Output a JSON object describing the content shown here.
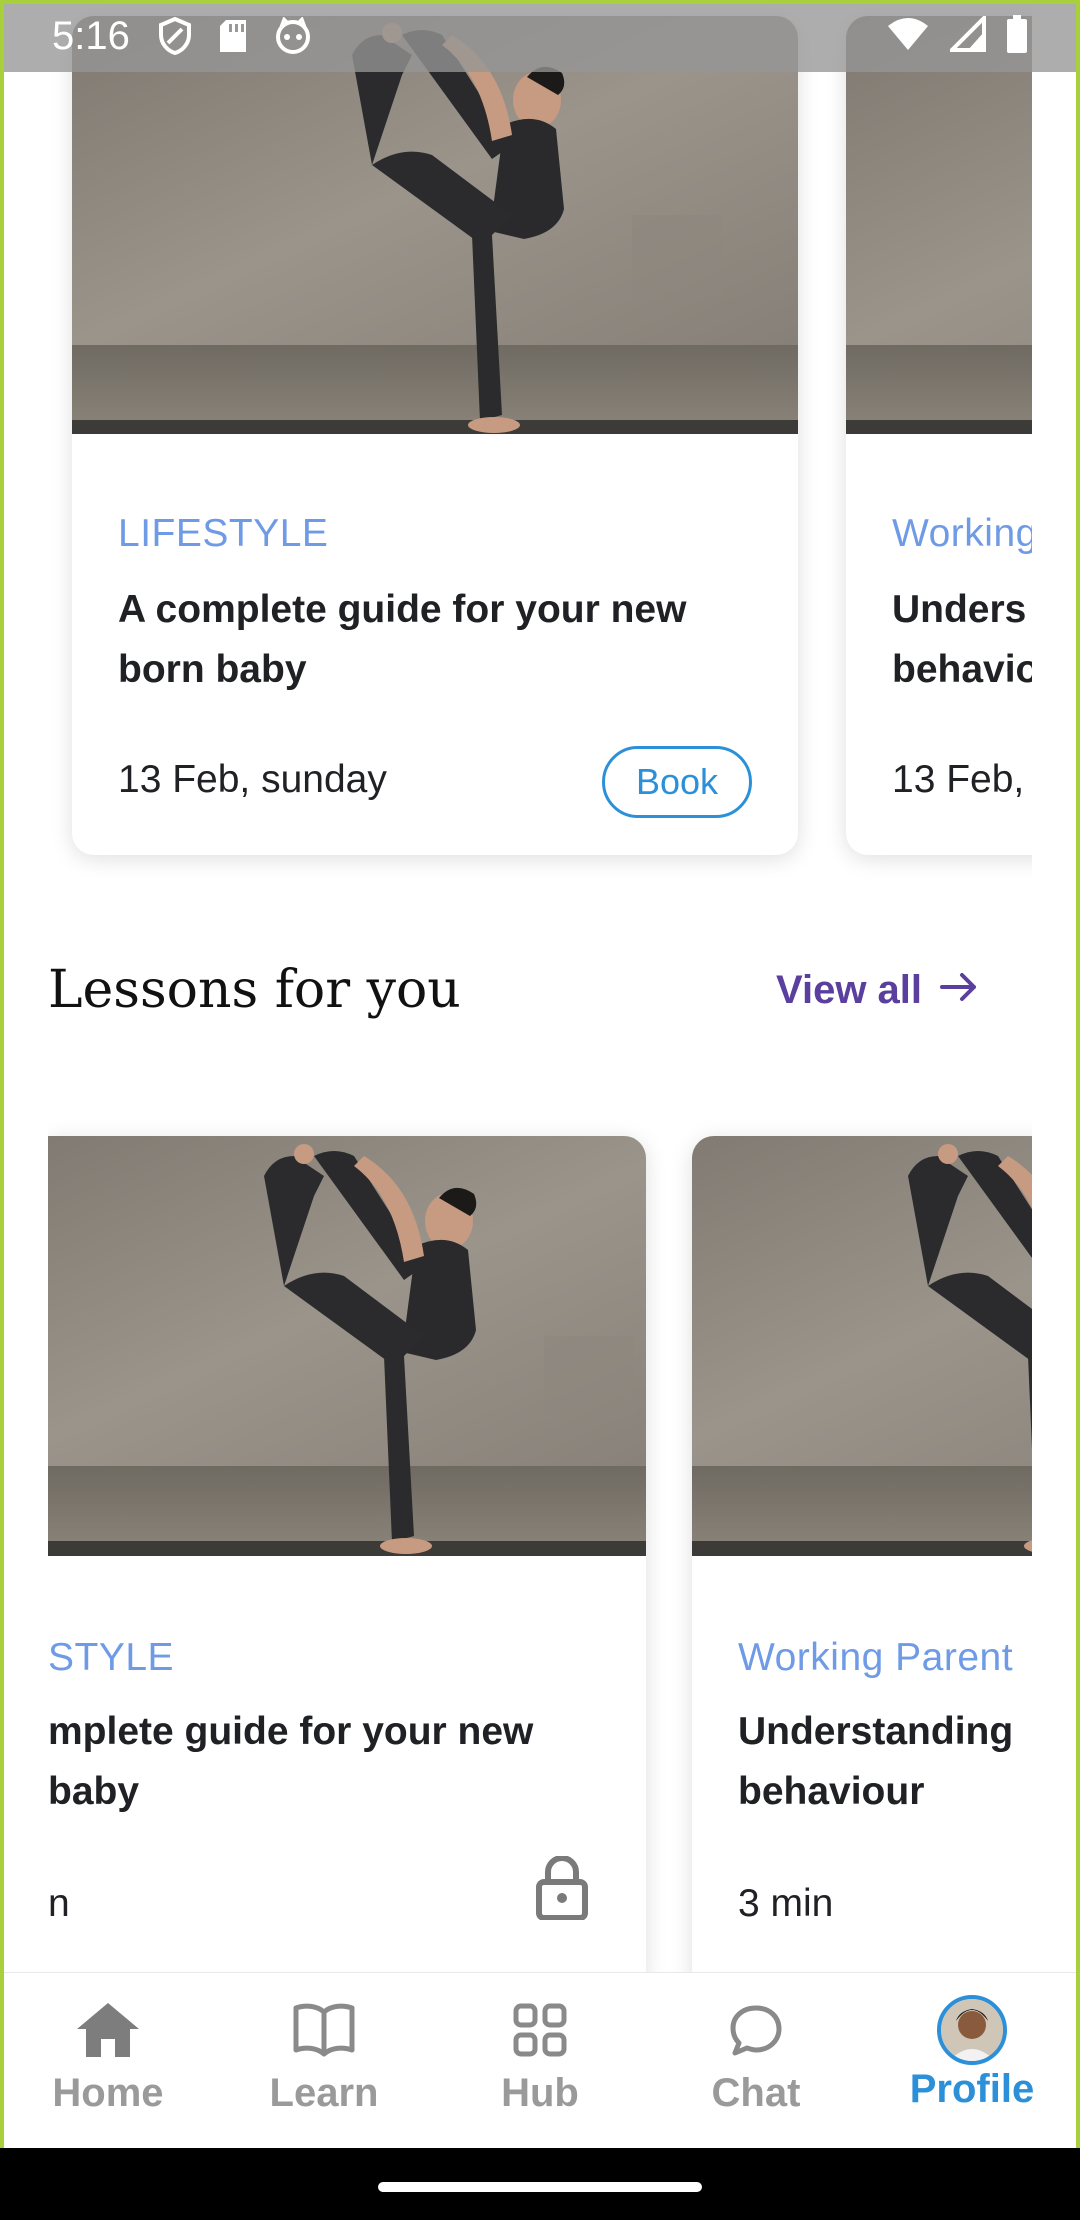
{
  "status_bar": {
    "time": "5:16",
    "icons": [
      "shield-icon",
      "sd-card-icon",
      "cat-face-icon",
      "wifi-icon",
      "signal-icon",
      "battery-icon"
    ]
  },
  "top_cards": [
    {
      "category": "LIFESTYLE",
      "title_line1": "A complete guide for your new",
      "title_line2": "born baby",
      "date": "13 Feb, sunday",
      "action_label": "Book"
    },
    {
      "category": "Working",
      "title_line1": "Unders",
      "title_line2": "behavio",
      "date": "13 Feb,"
    }
  ],
  "lessons_section": {
    "title": "Lessons for you",
    "view_all_label": "View all"
  },
  "lesson_cards": [
    {
      "category": "STYLE",
      "title_line1": "mplete guide for your new",
      "title_line2": "baby",
      "duration": "n",
      "locked": true
    },
    {
      "category": "Working Parent",
      "title_line1": "Understanding",
      "title_line2": "behaviour",
      "duration": "3 min"
    }
  ],
  "bottom_nav": {
    "items": [
      {
        "label": "Home",
        "icon": "home-icon"
      },
      {
        "label": "Learn",
        "icon": "book-icon"
      },
      {
        "label": "Hub",
        "icon": "grid-icon"
      },
      {
        "label": "Chat",
        "icon": "chat-bubble-icon"
      },
      {
        "label": "Profile",
        "icon": "avatar",
        "active": true
      }
    ]
  },
  "colors": {
    "category": "#6f9be6",
    "accent_blue": "#2c90d9",
    "view_all": "#5b3f9e",
    "frame": "#a8cf3c"
  }
}
